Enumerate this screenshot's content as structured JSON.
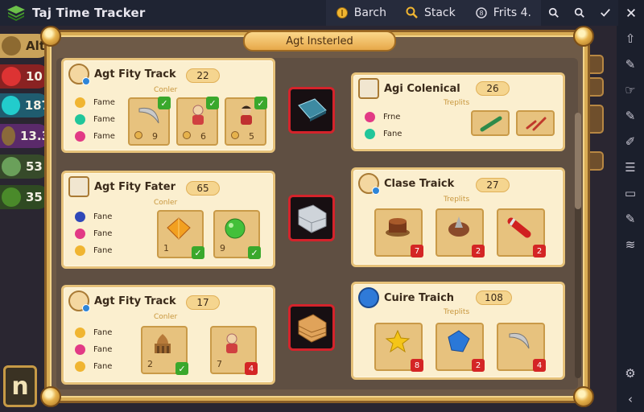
{
  "topbar": {
    "title": "Taj Time Tracker",
    "buttons": [
      {
        "label": "Barch",
        "icon": "coin-icon"
      },
      {
        "label": "Stack",
        "icon": "magnifier-icon"
      },
      {
        "label": "Frits 4.",
        "icon": "rotate-icon"
      }
    ],
    "icons": [
      "search-icon",
      "search-icon",
      "check-icon",
      "close-icon"
    ]
  },
  "background_game": {
    "chips": [
      {
        "value": "Alt"
      },
      {
        "value": "10"
      },
      {
        "value": "187"
      },
      {
        "value": "13.3"
      },
      {
        "value": "53"
      },
      {
        "value": "35"
      }
    ],
    "bottom_button": "n"
  },
  "dialog": {
    "title": "Agt Insterled"
  },
  "cards_left": [
    {
      "title": "Agt Fity Track",
      "count": "22",
      "sub_label": "Conler",
      "legend": [
        "Fame",
        "Fame",
        "Fame"
      ],
      "slots": [
        {
          "num": "9",
          "art": "sickle-icon"
        },
        {
          "num": "6",
          "art": "figure-icon"
        },
        {
          "num": "5",
          "art": "figure-icon"
        }
      ]
    },
    {
      "title": "Agt Fity Fater",
      "count": "65",
      "sub_label": "Conler",
      "legend": [
        "Fane",
        "Fane",
        "Fane"
      ],
      "slots": [
        {
          "num": "1",
          "art": "gem-icon"
        },
        {
          "num": "9",
          "art": "orb-icon"
        }
      ]
    },
    {
      "title": "Agt Fity Track",
      "count": "17",
      "sub_label": "Conler",
      "legend": [
        "Fane",
        "Fane",
        "Fane"
      ],
      "slots": [
        {
          "num": "2",
          "art": "temple-icon"
        },
        {
          "num": "7",
          "art": "figure-icon",
          "badge": "4"
        }
      ]
    }
  ],
  "cards_right": [
    {
      "title": "Agi Colenical",
      "count": "26",
      "sub_label": "Treplits",
      "legend": [
        "Frne",
        "Fane"
      ],
      "slots": [
        {
          "art": "tube-icon"
        },
        {
          "art": "tool-icon"
        }
      ]
    },
    {
      "title": "Clase Traick",
      "count": "27",
      "sub_label": "Treplits",
      "slots": [
        {
          "badge": "7",
          "art": "cake-icon"
        },
        {
          "badge": "2",
          "art": "drill-icon"
        },
        {
          "badge": "2",
          "art": "canister-icon"
        }
      ]
    },
    {
      "title": "Cuire Traich",
      "count": "108",
      "sub_label": "Treplits",
      "slots": [
        {
          "badge": "8",
          "art": "star-icon"
        },
        {
          "badge": "2",
          "art": "sapphire-icon"
        },
        {
          "badge": "4",
          "art": "sickle-icon"
        }
      ]
    }
  ],
  "colors": {
    "accent": "#d9ac55",
    "card": "#fbefcf",
    "badge_red": "#d42525",
    "check_green": "#3aa82c"
  }
}
